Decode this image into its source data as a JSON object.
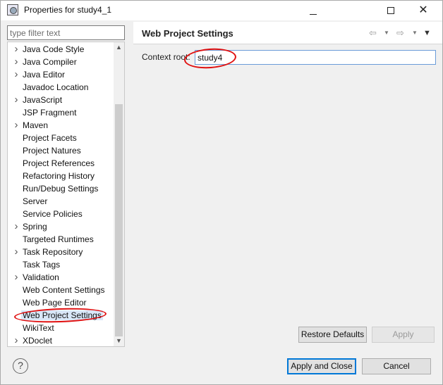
{
  "window": {
    "title": "Properties for study4_1",
    "minimize_label": "—",
    "close_label": "✕"
  },
  "sidebar": {
    "filter_placeholder": "type filter text",
    "items": [
      {
        "label": "Java Code Style",
        "expandable": true
      },
      {
        "label": "Java Compiler",
        "expandable": true
      },
      {
        "label": "Java Editor",
        "expandable": true
      },
      {
        "label": "Javadoc Location",
        "expandable": false
      },
      {
        "label": "JavaScript",
        "expandable": true
      },
      {
        "label": "JSP Fragment",
        "expandable": false
      },
      {
        "label": "Maven",
        "expandable": true
      },
      {
        "label": "Project Facets",
        "expandable": false
      },
      {
        "label": "Project Natures",
        "expandable": false
      },
      {
        "label": "Project References",
        "expandable": false
      },
      {
        "label": "Refactoring History",
        "expandable": false
      },
      {
        "label": "Run/Debug Settings",
        "expandable": false
      },
      {
        "label": "Server",
        "expandable": false
      },
      {
        "label": "Service Policies",
        "expandable": false
      },
      {
        "label": "Spring",
        "expandable": true
      },
      {
        "label": "Targeted Runtimes",
        "expandable": false
      },
      {
        "label": "Task Repository",
        "expandable": true
      },
      {
        "label": "Task Tags",
        "expandable": false
      },
      {
        "label": "Validation",
        "expandable": true
      },
      {
        "label": "Web Content Settings",
        "expandable": false
      },
      {
        "label": "Web Page Editor",
        "expandable": false
      },
      {
        "label": "Web Project Settings",
        "expandable": false,
        "selected": true
      },
      {
        "label": "WikiText",
        "expandable": false
      },
      {
        "label": "XDoclet",
        "expandable": true
      }
    ]
  },
  "panel": {
    "title": "Web Project Settings",
    "context_root_label": "Context root:",
    "context_root_value": "study4",
    "restore_defaults_label": "Restore Defaults",
    "apply_label": "Apply"
  },
  "footer": {
    "help_label": "?",
    "apply_and_close_label": "Apply and Close",
    "cancel_label": "Cancel"
  },
  "icons": {
    "back": "back-arrow-icon",
    "forward": "forward-arrow-icon",
    "view_menu": "view-menu-icon"
  },
  "colors": {
    "annotation": "#e01010",
    "focus": "#0078d7",
    "selection": "#d9e7f8"
  }
}
